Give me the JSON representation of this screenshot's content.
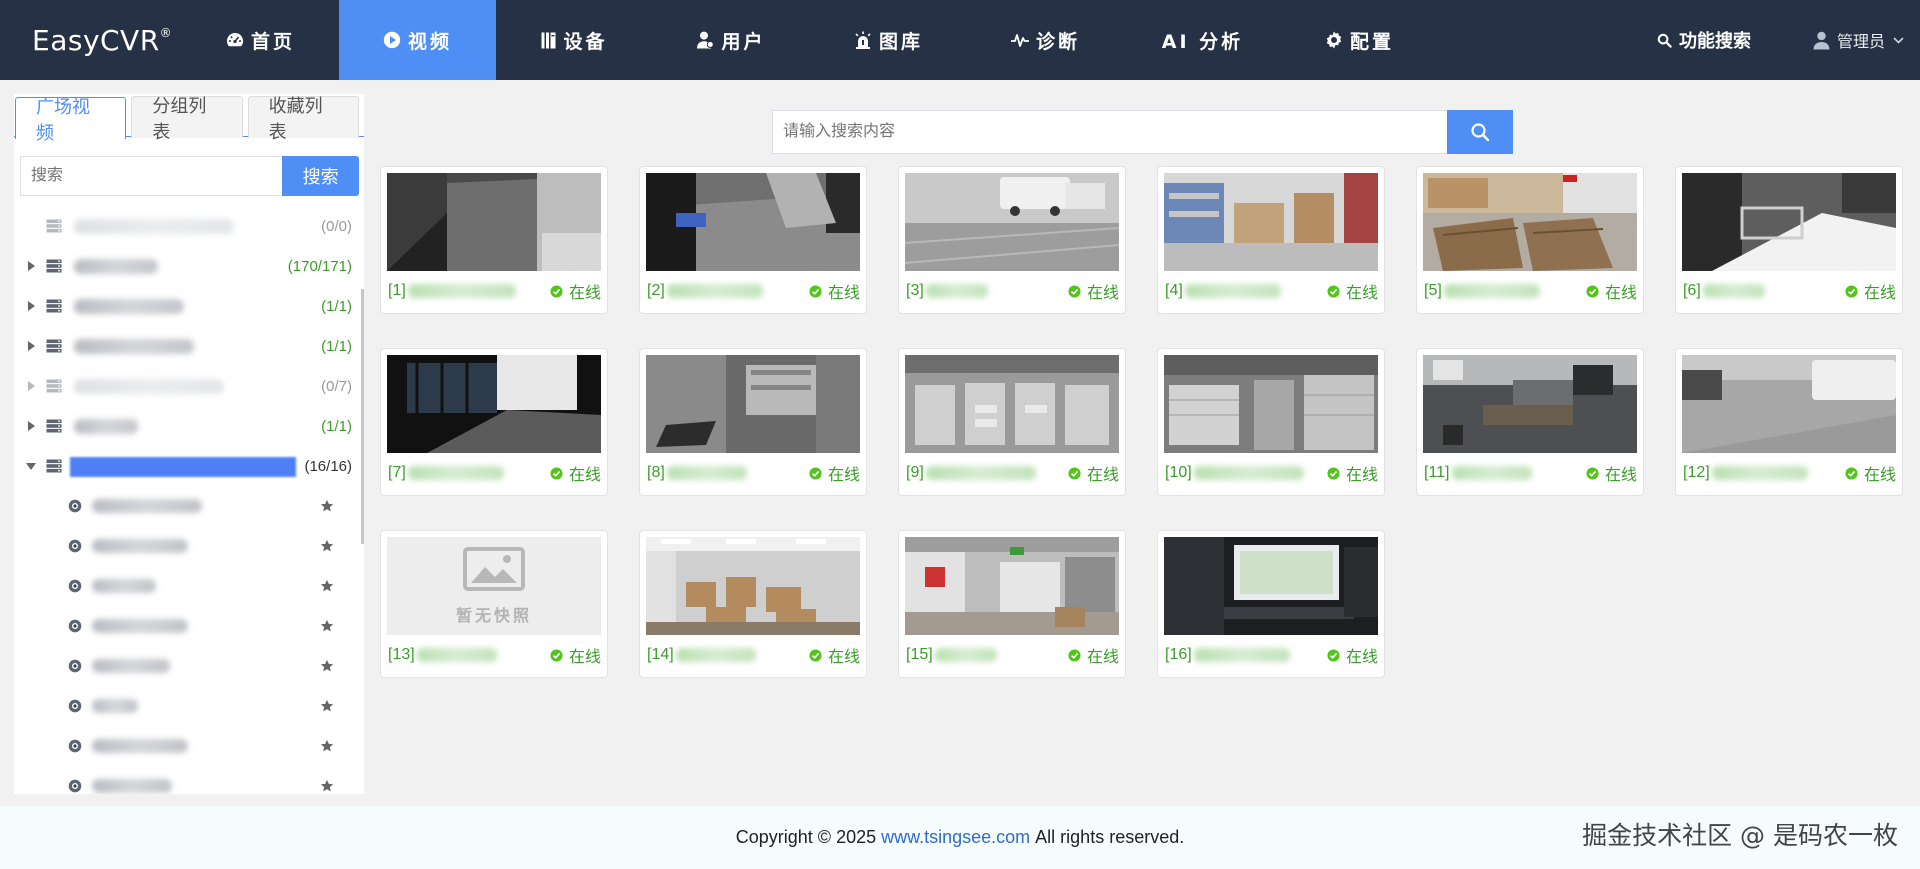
{
  "app": {
    "logo": "EasyCVR",
    "logo_mark": "®"
  },
  "nav": [
    {
      "label": "首页",
      "icon": "dashboard-icon",
      "active": false
    },
    {
      "label": "视频",
      "icon": "play-circle-icon",
      "active": true
    },
    {
      "label": "设备",
      "icon": "device-icon",
      "active": false
    },
    {
      "label": "用户",
      "icon": "user-icon",
      "active": false
    },
    {
      "label": "图库",
      "icon": "alarm-icon",
      "active": false
    },
    {
      "label": "诊断",
      "icon": "pulse-icon",
      "active": false
    },
    {
      "label": "AI 分析",
      "icon": "",
      "active": false
    },
    {
      "label": "配置",
      "icon": "gear-icon",
      "active": false
    }
  ],
  "topright": {
    "search_label": "功能搜索",
    "user_label": "管理员"
  },
  "sidebar": {
    "tabs": [
      "广场视频",
      "分组列表",
      "收藏列表"
    ],
    "search_placeholder": "搜索",
    "search_button": "搜索",
    "tree": [
      {
        "count": "(0/0)",
        "online": false,
        "expandable": false,
        "label_w": 160
      },
      {
        "count": "(170/171)",
        "online": true,
        "expandable": true,
        "label_w": 84
      },
      {
        "count": "(1/1)",
        "online": true,
        "expandable": true,
        "label_w": 110
      },
      {
        "count": "(1/1)",
        "online": true,
        "expandable": true,
        "label_w": 120
      },
      {
        "count": "(0/7)",
        "online": false,
        "expandable": true,
        "label_w": 150
      },
      {
        "count": "(1/1)",
        "online": true,
        "expandable": true,
        "label_w": 64
      },
      {
        "count": "(16/16)",
        "online": true,
        "expandable": true,
        "expanded": true,
        "selected": true,
        "label_w": 0
      }
    ],
    "children_label_w": [
      110,
      96,
      64,
      96,
      78,
      46,
      96,
      80
    ]
  },
  "main": {
    "search_placeholder": "请输入搜索内容",
    "status_label": "在线",
    "no_snapshot_label": "暂无快照",
    "cards": [
      {
        "prefix": "[1]",
        "label_w": 108,
        "scene": "s1"
      },
      {
        "prefix": "[2]",
        "label_w": 96,
        "scene": "s2"
      },
      {
        "prefix": "[3]",
        "label_w": 62,
        "scene": "s3"
      },
      {
        "prefix": "[4]",
        "label_w": 96,
        "scene": "s4"
      },
      {
        "prefix": "[5]",
        "label_w": 96,
        "scene": "s5"
      },
      {
        "prefix": "[6]",
        "label_w": 62,
        "scene": "s6"
      },
      {
        "prefix": "[7]",
        "label_w": 96,
        "scene": "s7"
      },
      {
        "prefix": "[8]",
        "label_w": 80,
        "scene": "s8"
      },
      {
        "prefix": "[9]",
        "label_w": 110,
        "scene": "s9"
      },
      {
        "prefix": "[10]",
        "label_w": 110,
        "scene": "s10"
      },
      {
        "prefix": "[11]",
        "label_w": 80,
        "scene": "s11"
      },
      {
        "prefix": "[12]",
        "label_w": 96,
        "scene": "s12"
      },
      {
        "prefix": "[13]",
        "label_w": 80,
        "scene": "none"
      },
      {
        "prefix": "[14]",
        "label_w": 80,
        "scene": "s14"
      },
      {
        "prefix": "[15]",
        "label_w": 62,
        "scene": "s15"
      },
      {
        "prefix": "[16]",
        "label_w": 96,
        "scene": "s16"
      }
    ]
  },
  "footer": {
    "prefix": "Copyright © 2025",
    "link": "www.tsingsee.com",
    "suffix": "All rights reserved."
  },
  "watermark": "掘金技术社区 @ 是码农一枚"
}
